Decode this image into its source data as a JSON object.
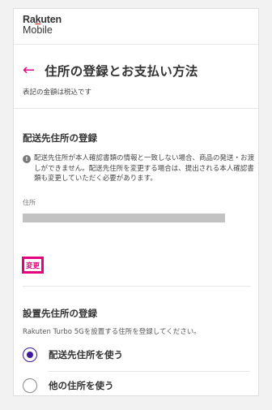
{
  "brand": {
    "top": "Rakuten",
    "bottom": "Mobile"
  },
  "header": {
    "back_icon": "arrow-left-icon",
    "title": "住所の登録とお支払い方法"
  },
  "tax_note": "表記の金額は税込です",
  "shipping": {
    "title": "配送先住所の登録",
    "notice": "配送先住所が本人確認書類の情報と一致しない場合、商品の発送・お渡しができません。配送先住所を変更する場合は、提出される本人確認書類も変更していただく必要があります。",
    "address_label": "住所",
    "address_value": "",
    "change_label": "変更"
  },
  "installation": {
    "title": "設置先住所の登録",
    "description": "Rakuten Turbo 5Gを設置する住所を登録してください。",
    "options": [
      {
        "label": "配送先住所を使う",
        "selected": true
      },
      {
        "label": "他の住所を使う",
        "selected": false
      }
    ]
  },
  "colors": {
    "accent": "#e4007f",
    "radio_selected": "#3f1a9a",
    "brand_red": "#bf0000"
  }
}
